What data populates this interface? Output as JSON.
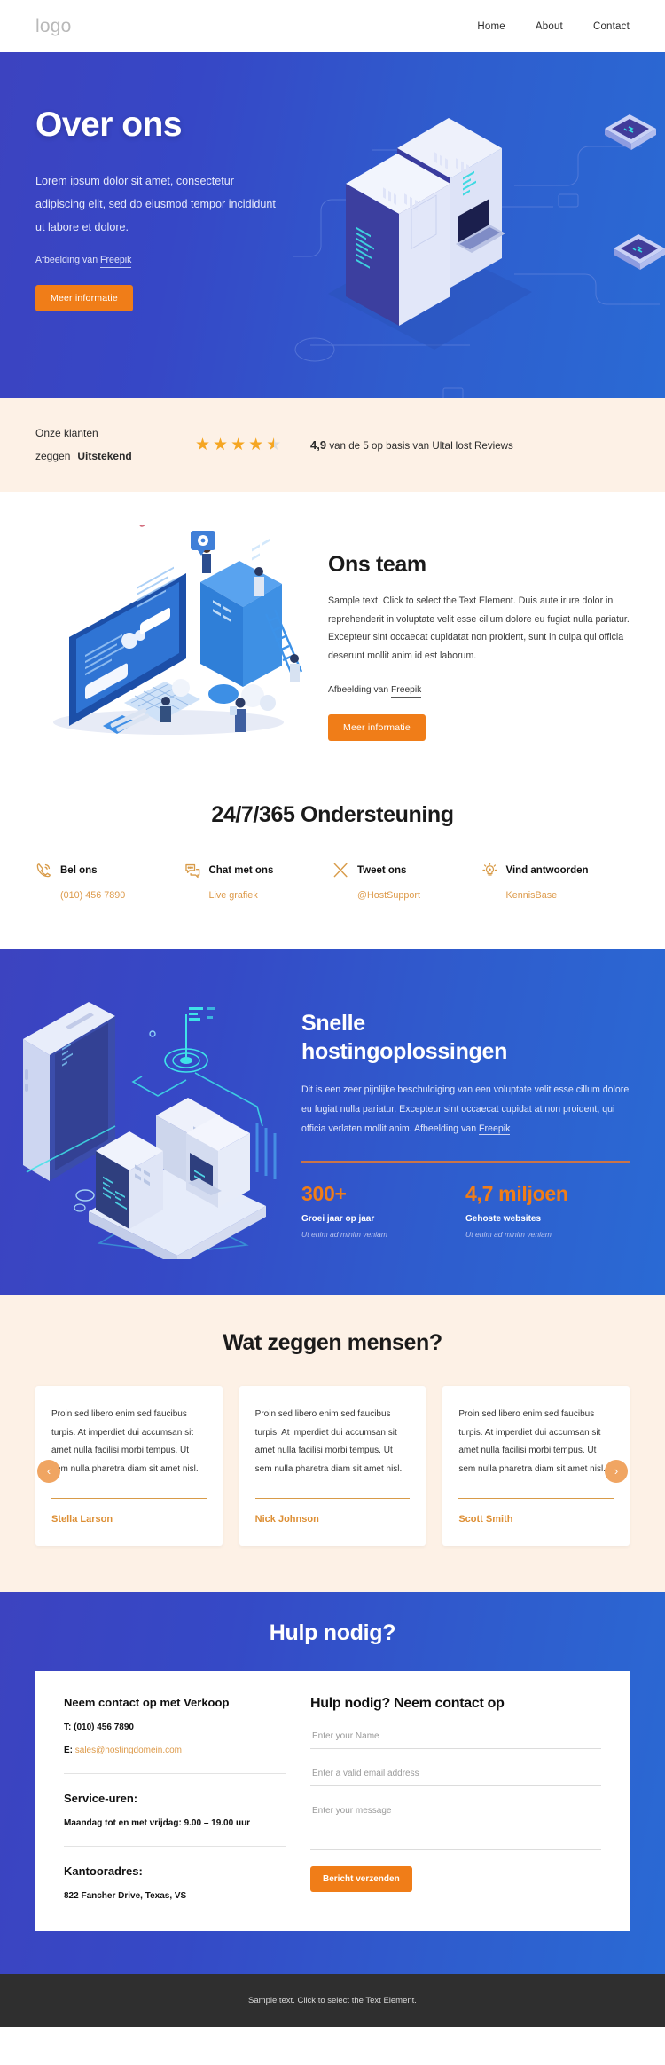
{
  "header": {
    "logo": "logo",
    "nav": [
      {
        "label": "Home"
      },
      {
        "label": "About"
      },
      {
        "label": "Contact"
      }
    ]
  },
  "hero": {
    "title": "Over ons",
    "lead": "Lorem ipsum dolor sit amet, consectetur adipiscing elit, sed do eiusmod tempor incididunt ut labore et dolore.",
    "credit_prefix": "Afbeelding van ",
    "credit_link": "Freepik",
    "cta": "Meer informatie",
    "bg_left": "#3c43c0",
    "bg_right": "#2a6ad4",
    "accent": "#f07d18"
  },
  "reviews": {
    "line1": "Onze klanten",
    "line2_prefix": "zeggen",
    "line2_bold": "Uitstekend",
    "rating_value": "4,9",
    "rating_text": "van de 5 op basis van UltaHost Reviews",
    "stars_full": 4,
    "stars_half": 1,
    "star_color": "#f5a623",
    "bg": "#fdf1e6"
  },
  "team": {
    "title": "Ons team",
    "body": "Sample text. Click to select the Text Element. Duis aute irure dolor in reprehenderit in voluptate velit esse cillum dolore eu fugiat nulla pariatur. Excepteur sint occaecat cupidatat non proident, sunt in culpa qui officia deserunt mollit anim id est laborum.",
    "credit_prefix": "Afbeelding van ",
    "credit_link": "Freepik",
    "cta": "Meer informatie"
  },
  "support": {
    "title": "24/7/365 Ondersteuning",
    "items": [
      {
        "icon": "phone-icon",
        "title": "Bel ons",
        "sub": "(010) 456 7890"
      },
      {
        "icon": "chat-icon",
        "title": "Chat met ons",
        "sub": "Live grafiek"
      },
      {
        "icon": "x-twitter-icon",
        "title": "Tweet ons",
        "sub": "@HostSupport"
      },
      {
        "icon": "lightbulb-icon",
        "title": "Vind antwoorden",
        "sub": "KennisBase"
      }
    ],
    "icon_color": "#d89b49"
  },
  "hosting": {
    "title_line1": "Snelle",
    "title_line2": "hostingoplossingen",
    "body": "Dit is een zeer pijnlijke beschuldiging van een voluptate velit esse cillum dolore eu fugiat nulla pariatur. Excepteur sint occaecat cupidat at non proident, qui officia verlaten mollit anim. ",
    "credit_prefix": "Afbeelding van ",
    "credit_link": "Freepik",
    "stats": [
      {
        "value": "300+",
        "label": "Groei jaar op jaar",
        "sub": "Ut enim ad minim veniam"
      },
      {
        "value": "4,7 miljoen",
        "label": "Gehoste websites",
        "sub": "Ut enim ad minim veniam"
      }
    ],
    "stat_color": "#f07d18"
  },
  "testimonials": {
    "title": "Wat zeggen mensen?",
    "prev_icon": "chevron-left-icon",
    "next_icon": "chevron-right-icon",
    "cards": [
      {
        "quote": "Proin sed libero enim sed faucibus turpis. At imperdiet dui accumsan sit amet nulla facilisi morbi tempus. Ut sem nulla pharetra diam sit amet nisl.",
        "author": "Stella Larson"
      },
      {
        "quote": "Proin sed libero enim sed faucibus turpis. At imperdiet dui accumsan sit amet nulla facilisi morbi tempus. Ut sem nulla pharetra diam sit amet nisl.",
        "author": "Nick Johnson"
      },
      {
        "quote": "Proin sed libero enim sed faucibus turpis. At imperdiet dui accumsan sit amet nulla facilisi morbi tempus. Ut sem nulla pharetra diam sit amet nisl.",
        "author": "Scott Smith"
      }
    ]
  },
  "contact": {
    "title": "Hulp nodig?",
    "sales_heading": "Neem contact op met Verkoop",
    "phone_label": "T:",
    "phone_value": " (010) 456 7890",
    "email_label": "E:",
    "email_value": " sales@hostingdomein.com",
    "hours_heading": "Service-uren:",
    "hours_value": "Maandag tot en met vrijdag: 9.00 – 19.00 uur",
    "address_heading": "Kantooradres:",
    "address_value": "822 Fancher Drive, Texas, VS",
    "form_heading": "Hulp nodig? Neem contact op",
    "name_placeholder": "Enter your Name",
    "email_placeholder": "Enter a valid email address",
    "message_placeholder": "Enter your message",
    "submit": "Bericht verzenden"
  },
  "footer": {
    "text": "Sample text. Click to select the Text Element."
  }
}
